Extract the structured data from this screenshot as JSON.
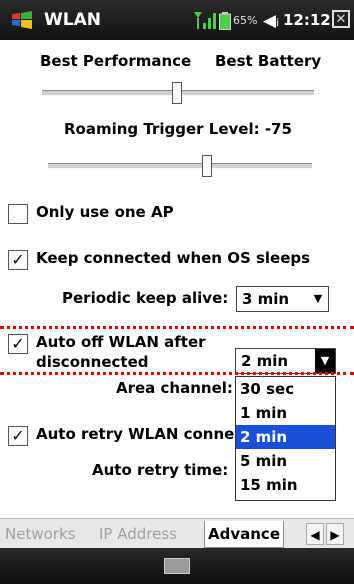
{
  "titlebar": {
    "title": "WLAN",
    "battery": "65%",
    "time": "12:12",
    "close_label": "OK"
  },
  "power": {
    "left_label": "Best Performance",
    "right_label": "Best Battery"
  },
  "roaming": {
    "label": "Roaming Trigger Level: -75"
  },
  "only_one_ap": {
    "label": "Only use one AP",
    "checked": false
  },
  "keep_connected": {
    "label": "Keep connected when OS sleeps",
    "checked": true
  },
  "keep_alive": {
    "label": "Periodic keep alive:",
    "value": "3 min"
  },
  "auto_off": {
    "line1": "Auto off WLAN after",
    "line2": "disconnected",
    "checked": true,
    "value": "2 min",
    "options": [
      "30 sec",
      "1 min",
      "2 min",
      "5 min",
      "15 min"
    ],
    "selected": "2 min"
  },
  "area_channel": {
    "label": "Area channel:"
  },
  "auto_retry": {
    "label": "Auto retry WLAN conne",
    "checked": true
  },
  "auto_retry_time": {
    "label": "Auto retry time:"
  },
  "tabs": [
    "Networks",
    "IP Address",
    "Advance"
  ],
  "active_tab": "Advance",
  "colors": {
    "selection": "#1a4fd8",
    "annotation_line": "#e00000"
  }
}
